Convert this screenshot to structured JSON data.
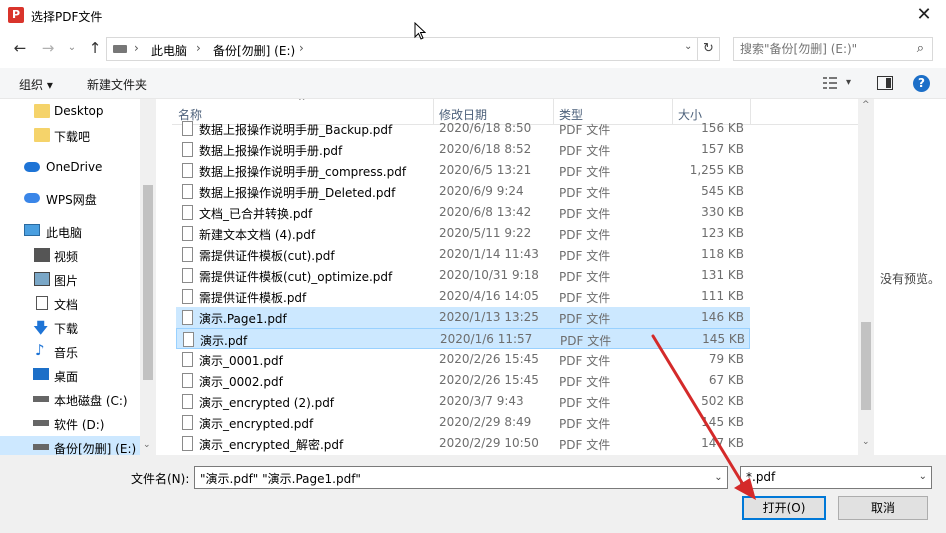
{
  "window": {
    "title": "选择PDF文件",
    "app_icon_letter": "P"
  },
  "address": {
    "segments": [
      "此电脑",
      "备份[勿删] (E:)"
    ],
    "search_placeholder": "搜索\"备份[勿删] (E:)\""
  },
  "toolbar": {
    "organize": "组织 ▾",
    "new_folder": "新建文件夹"
  },
  "nav": [
    {
      "label": "Desktop",
      "icon": "folder-icon"
    },
    {
      "label": "下载吧",
      "icon": "folder-icon"
    },
    {
      "label": "OneDrive",
      "icon": "cloud-icon"
    },
    {
      "label": "WPS网盘",
      "icon": "cloud-icon"
    },
    {
      "label": "此电脑",
      "icon": "computer-icon"
    },
    {
      "label": "视频",
      "icon": "video-icon"
    },
    {
      "label": "图片",
      "icon": "picture-icon"
    },
    {
      "label": "文档",
      "icon": "document-icon"
    },
    {
      "label": "下载",
      "icon": "download-icon"
    },
    {
      "label": "音乐",
      "icon": "music-icon"
    },
    {
      "label": "桌面",
      "icon": "desktop-icon"
    },
    {
      "label": "本地磁盘 (C:)",
      "icon": "drive-icon"
    },
    {
      "label": "软件 (D:)",
      "icon": "drive-icon"
    },
    {
      "label": "备份[勿删] (E:)",
      "icon": "drive-icon"
    }
  ],
  "columns": {
    "name": "名称",
    "date": "修改日期",
    "type": "类型",
    "size": "大小"
  },
  "files": [
    {
      "name": "数据上报操作说明手册_Backup.pdf",
      "date": "2020/6/18 8:50",
      "type": "PDF 文件",
      "size": "156 KB"
    },
    {
      "name": "数据上报操作说明手册.pdf",
      "date": "2020/6/18 8:52",
      "type": "PDF 文件",
      "size": "157 KB"
    },
    {
      "name": "数据上报操作说明手册_compress.pdf",
      "date": "2020/6/5 13:21",
      "type": "PDF 文件",
      "size": "1,255 KB"
    },
    {
      "name": "数据上报操作说明手册_Deleted.pdf",
      "date": "2020/6/9 9:24",
      "type": "PDF 文件",
      "size": "545 KB"
    },
    {
      "name": "文档_已合并转换.pdf",
      "date": "2020/6/8 13:42",
      "type": "PDF 文件",
      "size": "330 KB"
    },
    {
      "name": "新建文本文档 (4).pdf",
      "date": "2020/5/11 9:22",
      "type": "PDF 文件",
      "size": "123 KB"
    },
    {
      "name": "需提供证件模板(cut).pdf",
      "date": "2020/1/14 11:43",
      "type": "PDF 文件",
      "size": "118 KB"
    },
    {
      "name": "需提供证件模板(cut)_optimize.pdf",
      "date": "2020/10/31 9:18",
      "type": "PDF 文件",
      "size": "131 KB"
    },
    {
      "name": "需提供证件模板.pdf",
      "date": "2020/4/16 14:05",
      "type": "PDF 文件",
      "size": "111 KB"
    },
    {
      "name": "演示.Page1.pdf",
      "date": "2020/1/13 13:25",
      "type": "PDF 文件",
      "size": "146 KB",
      "selected": true
    },
    {
      "name": "演示.pdf",
      "date": "2020/1/6 11:57",
      "type": "PDF 文件",
      "size": "145 KB",
      "selected": true
    },
    {
      "name": "演示_0001.pdf",
      "date": "2020/2/26 15:45",
      "type": "PDF 文件",
      "size": "79 KB"
    },
    {
      "name": "演示_0002.pdf",
      "date": "2020/2/26 15:45",
      "type": "PDF 文件",
      "size": "67 KB"
    },
    {
      "name": "演示_encrypted (2).pdf",
      "date": "2020/3/7 9:43",
      "type": "PDF 文件",
      "size": "502 KB"
    },
    {
      "name": "演示_encrypted.pdf",
      "date": "2020/2/29 8:49",
      "type": "PDF 文件",
      "size": "145 KB"
    },
    {
      "name": "演示_encrypted_解密.pdf",
      "date": "2020/2/29 10:50",
      "type": "PDF 文件",
      "size": "147 KB"
    }
  ],
  "preview": {
    "empty_text": "没有预览。"
  },
  "bottom": {
    "filename_label": "文件名(N):",
    "filename_value": "\"演示.pdf\" \"演示.Page1.pdf\"",
    "filetype": "*.pdf",
    "open_label": "打开(O)",
    "cancel_label": "取消"
  },
  "colors": {
    "selection": "#cce8ff",
    "accent": "#0078d7",
    "annotation_arrow": "#d42a2a"
  }
}
